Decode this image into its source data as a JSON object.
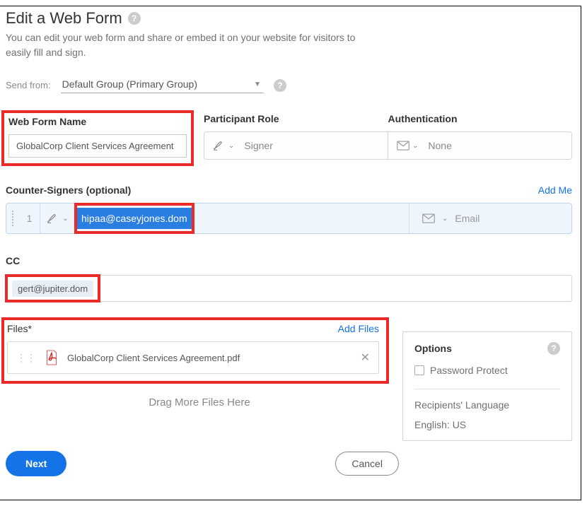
{
  "header": {
    "title": "Edit a Web Form",
    "subtitle": "You can edit your web form and share or embed it on your website for visitors to easily fill and sign."
  },
  "send_from": {
    "label": "Send from:",
    "value": "Default Group (Primary Group)"
  },
  "form_name": {
    "label": "Web Form Name",
    "value": "GlobalCorp Client Services Agreement"
  },
  "participant_role": {
    "label": "Participant Role",
    "value": "Signer"
  },
  "authentication": {
    "label": "Authentication",
    "value": "None"
  },
  "counter_signers": {
    "label": "Counter-Signers (optional)",
    "add_me": "Add Me",
    "rows": [
      {
        "order": "1",
        "email_fragment": "hipaa@caseyjones.dom",
        "auth_placeholder": "Email"
      }
    ]
  },
  "cc": {
    "label": "CC",
    "chips": [
      "gert@jupiter.dom"
    ]
  },
  "files": {
    "label": "Files*",
    "add_files": "Add Files",
    "items": [
      {
        "name": "GlobalCorp Client Services Agreement.pdf"
      }
    ],
    "drag_text": "Drag More Files Here"
  },
  "options": {
    "title": "Options",
    "password_protect": "Password Protect",
    "language_label": "Recipients' Language",
    "language_value": "English: US"
  },
  "buttons": {
    "next": "Next",
    "cancel": "Cancel"
  }
}
